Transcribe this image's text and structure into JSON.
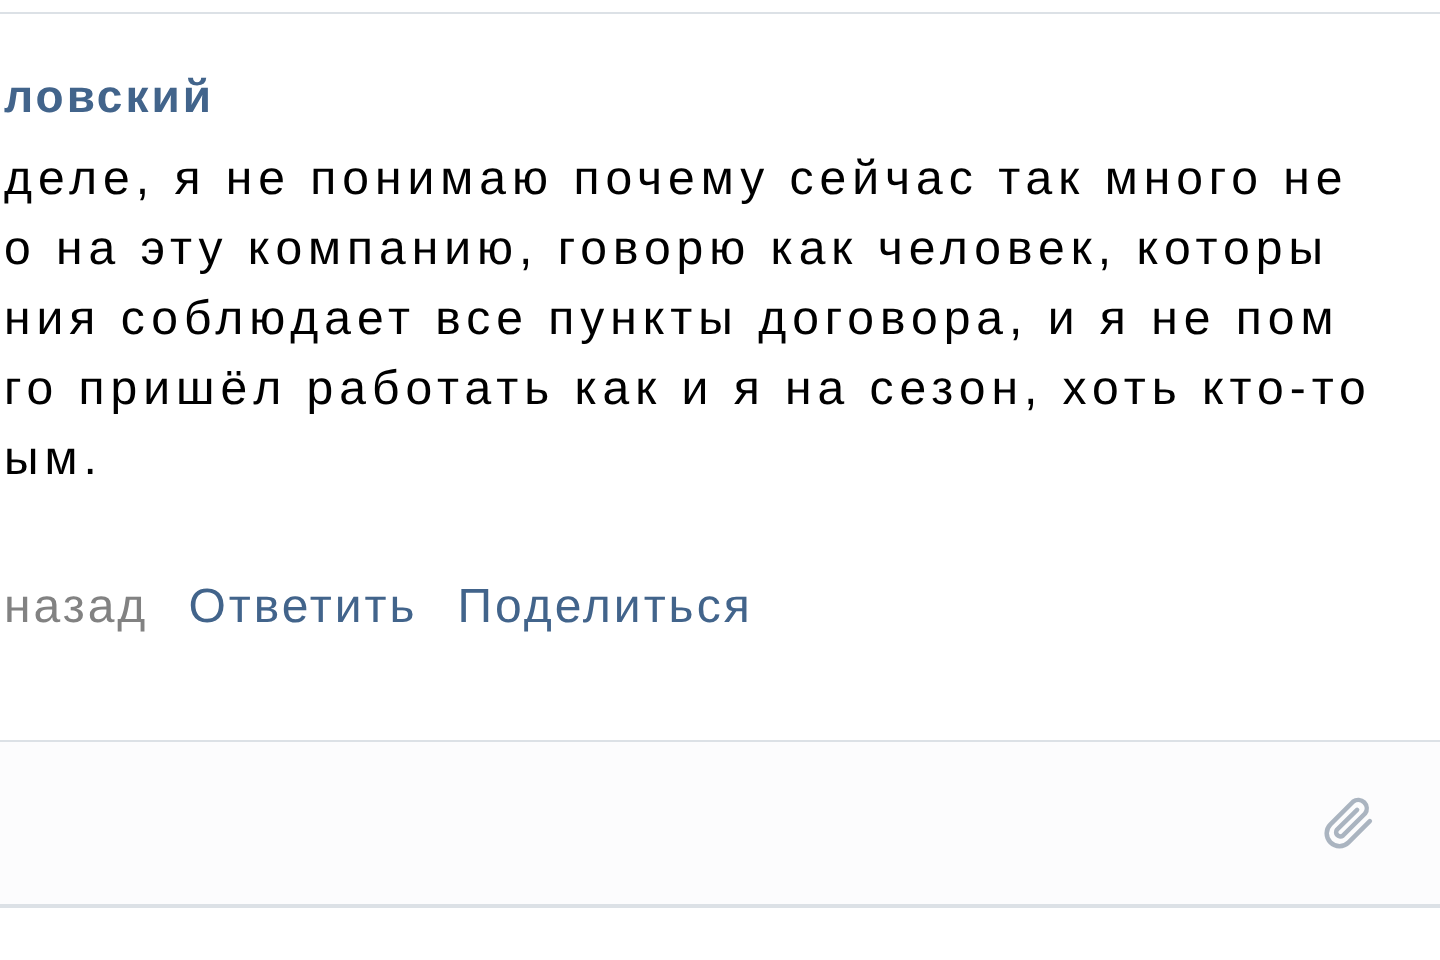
{
  "comment": {
    "author": "ловский",
    "lines": [
      "деле, я не понимаю почему сейчас так много не",
      "о на эту компанию, говорю как человек, которы",
      "ния соблюдает все пункты договора, и я не пом",
      "го пришёл работать как и я на сезон, хоть кто-то",
      "ым."
    ],
    "time": "назад",
    "actions": [
      "Ответить",
      "Поделиться"
    ]
  }
}
